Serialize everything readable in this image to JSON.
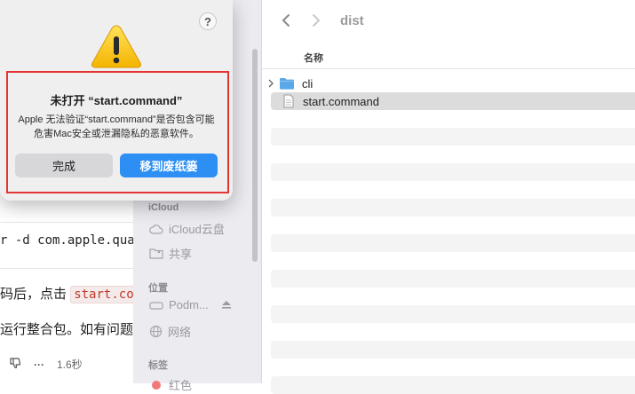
{
  "doc": {
    "code_line": "r -d com.apple.qua",
    "para1_prefix": "码后，点击",
    "para1_code": "start.com",
    "para2": "运行整合包。如有问题",
    "timing": "1.6秒",
    "more": "···"
  },
  "finder": {
    "folder_title": "dist",
    "column_name": "名称",
    "files": [
      {
        "name": "cli",
        "kind": "folder",
        "selected": false
      },
      {
        "name": "start.command",
        "kind": "file",
        "selected": true
      }
    ],
    "sidebar": {
      "icloud_section": "iCloud",
      "icloud_drive": "iCloud云盘",
      "shared": "共享",
      "locations_section": "位置",
      "podman": "Podm...",
      "network": "网络",
      "tags_section": "标签",
      "red_tag": "红色"
    }
  },
  "dialog": {
    "help": "?",
    "title": "未打开 “start.command”",
    "message": "Apple 无法验证“start.command”是否包含可能危害Mac安全或泄漏隐私的恶意软件。",
    "done_button": "完成",
    "trash_button": "移到废纸篓"
  },
  "colors": {
    "accent": "#2d8ff3",
    "highlight": "#e53434",
    "folder": "#5aa8e8"
  }
}
